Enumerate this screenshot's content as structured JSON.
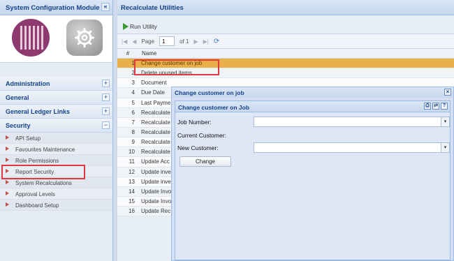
{
  "left_panel": {
    "title": "System Configuration Module",
    "collapse_glyph": "«",
    "sections": [
      {
        "label": "Administration",
        "toggle": "+"
      },
      {
        "label": "General",
        "toggle": "+"
      },
      {
        "label": "General Ledger Links",
        "toggle": "+"
      },
      {
        "label": "Security",
        "toggle": "−"
      }
    ],
    "security_items": [
      "API Setup",
      "Favourites Maintenance",
      "Role Permissions",
      "Report Security",
      "System Recalculations",
      "Approval Levels",
      "Dashboard Setup"
    ]
  },
  "right_panel": {
    "title": "Recalculate Utilities",
    "run_label": "Run Utility",
    "pager": {
      "page_label": "Page",
      "page_value": "1",
      "of_label": "of 1"
    },
    "columns": {
      "num": "#",
      "name": "Name"
    },
    "rows": [
      {
        "n": "1",
        "name": "Change customer on job"
      },
      {
        "n": "2",
        "name": "Delete unused items"
      },
      {
        "n": "3",
        "name": "Document"
      },
      {
        "n": "4",
        "name": "Due Date"
      },
      {
        "n": "5",
        "name": "Last Payme"
      },
      {
        "n": "6",
        "name": "Recalculate"
      },
      {
        "n": "7",
        "name": "Recalculate"
      },
      {
        "n": "8",
        "name": "Recalculate"
      },
      {
        "n": "9",
        "name": "Recalculate"
      },
      {
        "n": "10",
        "name": "Recalculate"
      },
      {
        "n": "11",
        "name": "Update Acc"
      },
      {
        "n": "12",
        "name": "Update inve"
      },
      {
        "n": "13",
        "name": "Update inve"
      },
      {
        "n": "14",
        "name": "Update Invo"
      },
      {
        "n": "15",
        "name": "Update Invo"
      },
      {
        "n": "16",
        "name": "Update Rec"
      }
    ]
  },
  "dialog": {
    "title": "Change customer on job",
    "close_glyph": "×",
    "inner_title": "Change customer on Job",
    "tool_glyphs": [
      "⎙",
      "⇄",
      "?"
    ],
    "job_number_label": "Job Number:",
    "current_customer_label": "Current Customer:",
    "new_customer_label": "New Customer:",
    "combo_glyph": "▾",
    "change_button": "Change"
  },
  "colors": {
    "selected_row": "#e9b04a",
    "highlight_box": "#e0383e",
    "header_text": "#15428b"
  }
}
